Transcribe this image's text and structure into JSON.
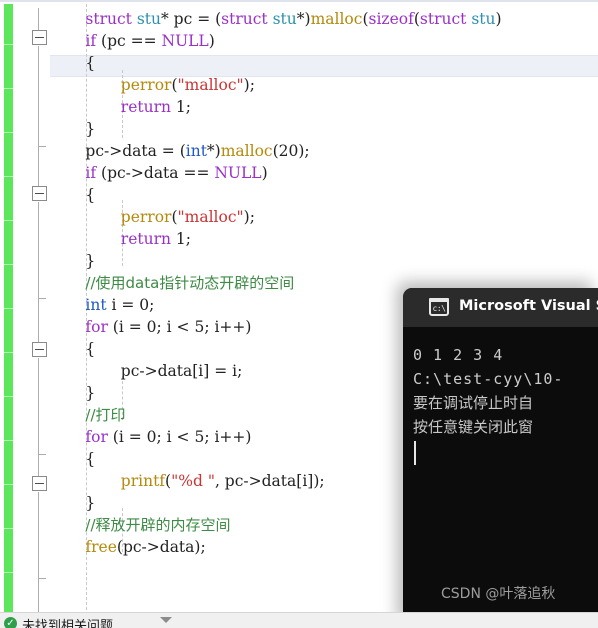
{
  "window": {
    "app": "Visual Studio Code Editor"
  },
  "editor": {
    "language": "C",
    "lines": [
      {
        "indent": 4,
        "parts": [
          {
            "t": "struct ",
            "c": "kw"
          },
          {
            "t": "stu",
            "c": "typ"
          },
          {
            "t": "* pc = (",
            "c": "pl"
          },
          {
            "t": "struct ",
            "c": "kw"
          },
          {
            "t": "stu",
            "c": "typ"
          },
          {
            "t": "*)",
            "c": "pl"
          },
          {
            "t": "malloc",
            "c": "fn"
          },
          {
            "t": "(",
            "c": "pl"
          },
          {
            "t": "sizeof",
            "c": "kw"
          },
          {
            "t": "(",
            "c": "pl"
          },
          {
            "t": "struct ",
            "c": "kw"
          },
          {
            "t": "stu",
            "c": "typ"
          },
          {
            "t": ")",
            "c": "pl"
          }
        ]
      },
      {
        "indent": 4,
        "parts": [
          {
            "t": "if",
            "c": "kw"
          },
          {
            "t": " (pc == ",
            "c": "pl"
          },
          {
            "t": "NULL",
            "c": "mac"
          },
          {
            "t": ")",
            "c": "pl"
          }
        ]
      },
      {
        "indent": 4,
        "parts": [
          {
            "t": "{",
            "c": "pl"
          }
        ]
      },
      {
        "indent": 8,
        "parts": [
          {
            "t": "perror",
            "c": "fn"
          },
          {
            "t": "(",
            "c": "pl"
          },
          {
            "t": "\"malloc\"",
            "c": "str"
          },
          {
            "t": ");",
            "c": "pl"
          }
        ]
      },
      {
        "indent": 8,
        "parts": [
          {
            "t": "return",
            "c": "kw"
          },
          {
            "t": " 1;",
            "c": "pl"
          }
        ]
      },
      {
        "indent": 4,
        "parts": [
          {
            "t": "}",
            "c": "pl"
          }
        ]
      },
      {
        "indent": 4,
        "parts": [
          {
            "t": "pc->data = (",
            "c": "pl"
          },
          {
            "t": "int",
            "c": "bt"
          },
          {
            "t": "*)",
            "c": "pl"
          },
          {
            "t": "malloc",
            "c": "fn"
          },
          {
            "t": "(20);",
            "c": "pl"
          }
        ]
      },
      {
        "indent": 4,
        "parts": [
          {
            "t": "if",
            "c": "kw"
          },
          {
            "t": " (pc->data == ",
            "c": "pl"
          },
          {
            "t": "NULL",
            "c": "mac"
          },
          {
            "t": ")",
            "c": "pl"
          }
        ]
      },
      {
        "indent": 4,
        "parts": [
          {
            "t": "{",
            "c": "pl"
          }
        ]
      },
      {
        "indent": 8,
        "parts": [
          {
            "t": "perror",
            "c": "fn"
          },
          {
            "t": "(",
            "c": "pl"
          },
          {
            "t": "\"malloc\"",
            "c": "str"
          },
          {
            "t": ");",
            "c": "pl"
          }
        ]
      },
      {
        "indent": 8,
        "parts": [
          {
            "t": "return",
            "c": "kw"
          },
          {
            "t": " 1;",
            "c": "pl"
          }
        ]
      },
      {
        "indent": 4,
        "parts": [
          {
            "t": "}",
            "c": "pl"
          }
        ]
      },
      {
        "indent": 4,
        "cn": true,
        "parts": [
          {
            "t": "//使用data指针动态开辟的空间",
            "c": "cmt"
          }
        ]
      },
      {
        "indent": 4,
        "parts": [
          {
            "t": "int",
            "c": "bt"
          },
          {
            "t": " i = 0;",
            "c": "pl"
          }
        ]
      },
      {
        "indent": 4,
        "parts": [
          {
            "t": "for",
            "c": "kw"
          },
          {
            "t": " (i = 0; i < 5; i++)",
            "c": "pl"
          }
        ]
      },
      {
        "indent": 4,
        "parts": [
          {
            "t": "{",
            "c": "pl"
          }
        ]
      },
      {
        "indent": 8,
        "parts": [
          {
            "t": "pc->data[i] = i;",
            "c": "pl"
          }
        ]
      },
      {
        "indent": 4,
        "parts": [
          {
            "t": "}",
            "c": "pl"
          }
        ]
      },
      {
        "indent": 4,
        "cn": true,
        "parts": [
          {
            "t": "//打印",
            "c": "cmt"
          }
        ]
      },
      {
        "indent": 4,
        "parts": [
          {
            "t": "for",
            "c": "kw"
          },
          {
            "t": " (i = 0; i < 5; i++)",
            "c": "pl"
          }
        ]
      },
      {
        "indent": 4,
        "parts": [
          {
            "t": "{",
            "c": "pl"
          }
        ]
      },
      {
        "indent": 8,
        "parts": [
          {
            "t": "printf",
            "c": "fn"
          },
          {
            "t": "(",
            "c": "pl"
          },
          {
            "t": "\"%d \"",
            "c": "str"
          },
          {
            "t": ", pc->data[i]);",
            "c": "pl"
          }
        ]
      },
      {
        "indent": 4,
        "parts": [
          {
            "t": "}",
            "c": "pl"
          }
        ]
      },
      {
        "indent": 4,
        "cn": true,
        "parts": [
          {
            "t": "//释放开辟的内存空间",
            "c": "cmt"
          }
        ]
      },
      {
        "indent": 4,
        "parts": [
          {
            "t": "free",
            "c": "fn"
          },
          {
            "t": "(pc->data);",
            "c": "pl"
          }
        ]
      }
    ],
    "colors": {
      "keyword": "#9b30c9",
      "user_type": "#2b91af",
      "builtin_type": "#1f57c8",
      "function": "#b5890b",
      "string": "#cc3333",
      "comment": "#3d8b45",
      "plain": "#222222",
      "change_bar": "#5ce65c",
      "current_line": "#eef0f7"
    }
  },
  "console": {
    "title": "Microsoft Visual Stu",
    "icon": "console-window-icon",
    "lines": [
      "0 1 2 3 4",
      "C:\\test-cyy\\10-",
      "要在调试停止时自",
      "按任意键关闭此窗"
    ],
    "watermark": "CSDN @叶落追秋",
    "colors": {
      "titlebar": "#2b2b2b",
      "background": "#0c0c0c",
      "text": "#cccccc"
    }
  },
  "statusbar": {
    "icon": "check-circle-icon",
    "icon_glyph": "✓",
    "text": "未找到相关问题",
    "chevron": "chevron-up-icon"
  }
}
